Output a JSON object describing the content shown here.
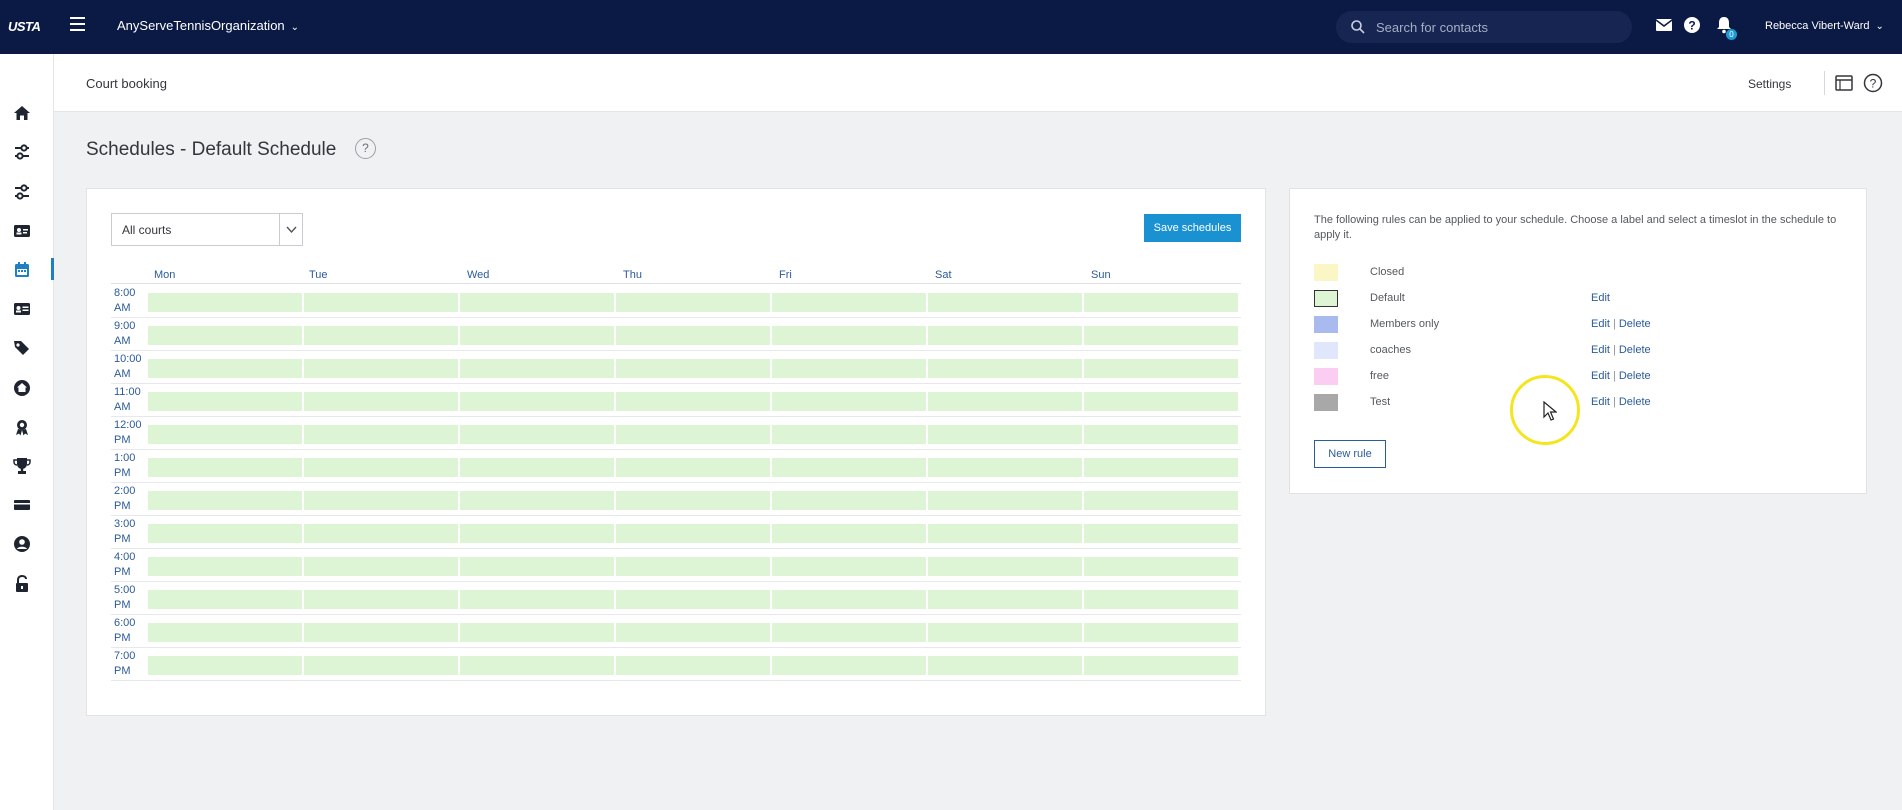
{
  "topbar": {
    "logo": "USTA",
    "org_name": "AnyServeTennisOrganization",
    "search_placeholder": "Search for contacts",
    "notification_count": "0",
    "user_name": "Rebecca Vibert-Ward"
  },
  "sidebar": {
    "items": [
      {
        "icon": "home-icon"
      },
      {
        "icon": "sliders-icon"
      },
      {
        "icon": "sliders-icon"
      },
      {
        "icon": "id-card-icon"
      },
      {
        "icon": "calendar-icon",
        "active": true
      },
      {
        "icon": "contact-card-icon"
      },
      {
        "icon": "tags-icon"
      },
      {
        "icon": "home-circle-icon"
      },
      {
        "icon": "award-icon"
      },
      {
        "icon": "trophy-icon"
      },
      {
        "icon": "ticket-icon"
      },
      {
        "icon": "user-circle-icon"
      },
      {
        "icon": "lock-icon"
      }
    ]
  },
  "page_header": {
    "title": "Court booking",
    "settings_label": "Settings"
  },
  "schedule": {
    "title": "Schedules - Default Schedule",
    "help_label": "?",
    "court_filter": "All courts",
    "save_label": "Save schedules",
    "days": [
      "Mon",
      "Tue",
      "Wed",
      "Thu",
      "Fri",
      "Sat",
      "Sun"
    ],
    "times": [
      "8:00 AM",
      "9:00 AM",
      "10:00 AM",
      "11:00 AM",
      "12:00 PM",
      "1:00 PM",
      "2:00 PM",
      "3:00 PM",
      "4:00 PM",
      "5:00 PM",
      "6:00 PM",
      "7:00 PM"
    ],
    "default_slot_color": "#ddf5d4"
  },
  "rules": {
    "intro": "The following rules can be applied to your schedule. Choose a label and select a timeslot in the schedule to apply it.",
    "items": [
      {
        "name": "Closed",
        "color": "#fbf6c5",
        "edit": "",
        "delete": ""
      },
      {
        "name": "Default",
        "color": "#ddf5d4",
        "edit": "Edit",
        "delete": ""
      },
      {
        "name": "Members only",
        "color": "#a9bbee",
        "edit": "Edit",
        "delete": "Delete"
      },
      {
        "name": "coaches",
        "color": "#e0e6fb",
        "edit": "Edit",
        "delete": "Delete"
      },
      {
        "name": "free",
        "color": "#fbcdf3",
        "edit": "Edit",
        "delete": "Delete"
      },
      {
        "name": "Test",
        "color": "#a8a8a8",
        "edit": "Edit",
        "delete": "Delete"
      }
    ],
    "separator": "|",
    "new_rule_label": "New rule"
  },
  "colors": {
    "topbar": "#0b1945",
    "accent": "#1a92d2",
    "link": "#2b5b9a"
  }
}
